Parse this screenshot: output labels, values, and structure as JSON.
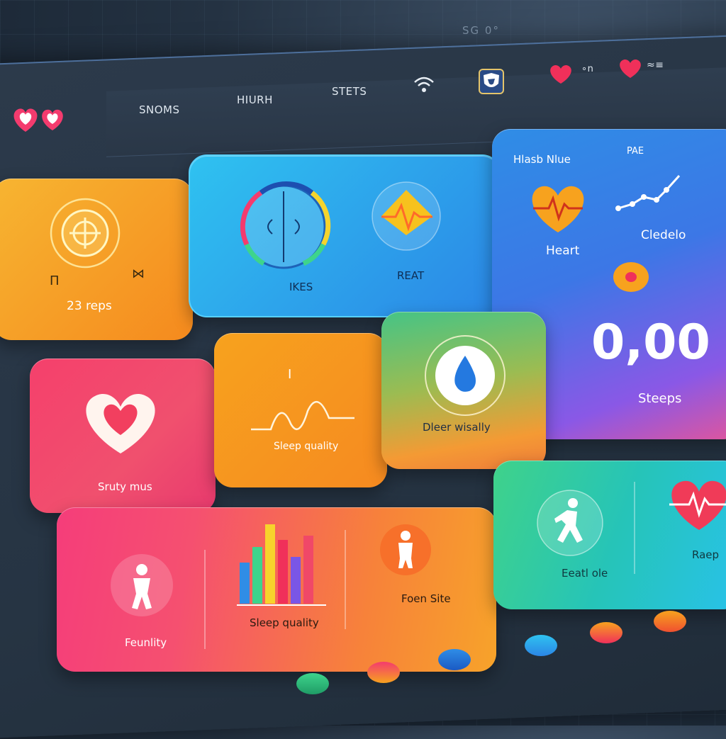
{
  "header": {
    "background_code": "SG 0°",
    "nav_items": [
      "SNOMS",
      "HIURH",
      "STETS"
    ],
    "status_right": [
      "∘n",
      "≈≡"
    ]
  },
  "cards": {
    "steps_card": {
      "label": "23 reps",
      "left_mark": "Π",
      "right_mark": "⋈"
    },
    "heart_gauge_card": {
      "label_left": "IKES",
      "label_right": "REAT"
    },
    "sidebar_card": {
      "title": "Hlasb Nlue",
      "small_label": "PAE",
      "heart_label": "Heart",
      "chart_label": "Cledelo",
      "big_value": "0,00",
      "big_value_label": "Steeps"
    },
    "heart_card": {
      "label": "Sruty mus"
    },
    "sleep_card": {
      "label": "Sleep quality",
      "marker": "I"
    },
    "water_card": {
      "label": "Dleer wisally"
    },
    "activity_card": {
      "label_left": "Feunlity",
      "label_middle": "Sleep quality",
      "label_right": "Foen Site"
    },
    "walk_card": {
      "label_left": "Eeatl ole",
      "label_right": "Raep"
    }
  },
  "colors": {
    "orange": "#f7a21e",
    "blue": "#2f8de6",
    "pink": "#f43b6e",
    "green": "#3ed48c",
    "red": "#f03b58"
  },
  "icons": [
    "heart-icon",
    "wifi-icon",
    "shield-icon",
    "target-icon",
    "gauge-icon",
    "pulse-icon",
    "line-chart-icon",
    "water-drop-icon",
    "walking-person-icon",
    "standing-person-icon",
    "bar-chart-icon"
  ]
}
